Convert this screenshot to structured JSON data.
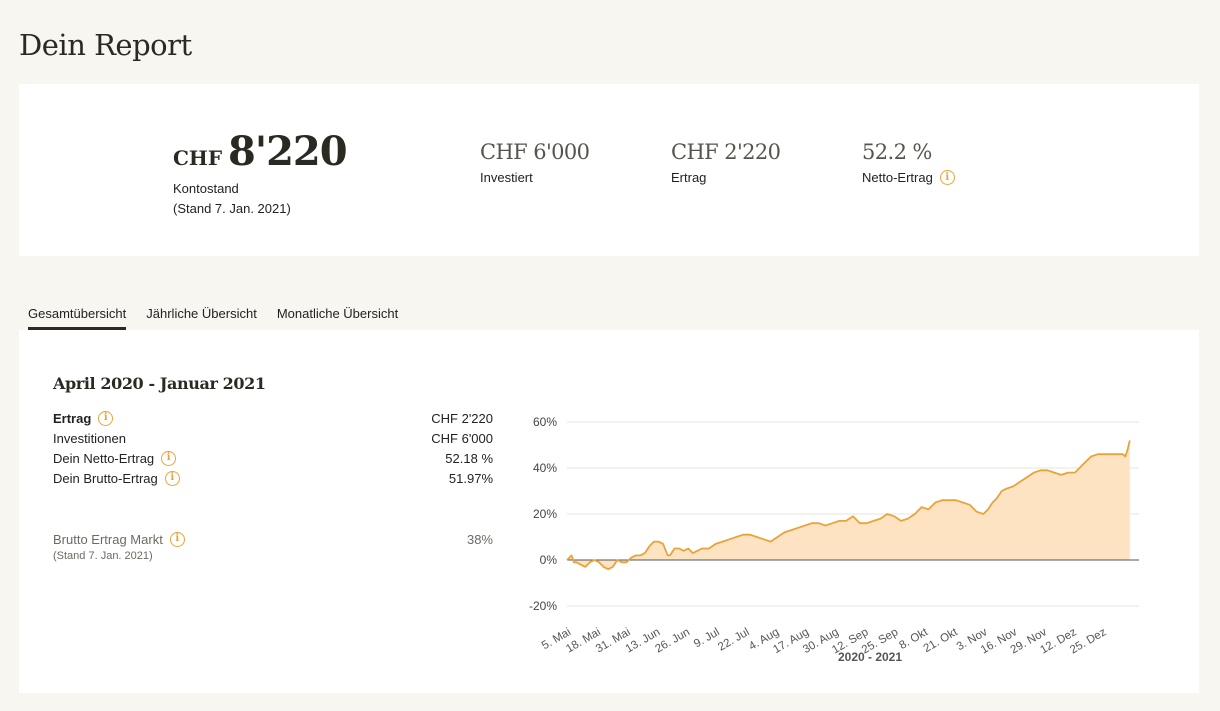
{
  "page": {
    "title": "Dein Report"
  },
  "summary": {
    "balance": {
      "currency": "CHF",
      "value": "8'220",
      "label": "Kontostand",
      "sublabel": "(Stand 7. Jan. 2021)"
    },
    "invested": {
      "value": "CHF 6'000",
      "label": "Investiert"
    },
    "earnings": {
      "value": "CHF 2'220",
      "label": "Ertrag"
    },
    "net_return": {
      "value": "52.2 %",
      "label": "Netto-Ertrag"
    }
  },
  "tabs": [
    {
      "label": "Gesamtübersicht",
      "active": true
    },
    {
      "label": "Jährliche Übersicht",
      "active": false
    },
    {
      "label": "Monatliche Übersicht",
      "active": false
    }
  ],
  "overview": {
    "period": "April 2020 - Januar 2021",
    "rows": [
      {
        "label": "Ertrag",
        "value": "CHF 2'220"
      },
      {
        "label": "Investitionen",
        "value": "CHF 6'000"
      },
      {
        "label": "Dein Netto-Ertrag",
        "value": "52.18 %"
      },
      {
        "label": "Dein Brutto-Ertrag",
        "value": "51.97%"
      }
    ],
    "market": {
      "label": "Brutto Ertrag Markt",
      "value": "38%",
      "sublabel": "(Stand 7. Jan. 2021)"
    }
  },
  "colors": {
    "accent": "#e8a43a",
    "fill": "#fde3c2",
    "text": "#2a2a22",
    "background": "#f8f6f1"
  },
  "chart_data": {
    "type": "area",
    "xlabel": "2020 - 2021",
    "ylabel": "",
    "y_ticks": [
      "60%",
      "40%",
      "20%",
      "0%",
      "-20%"
    ],
    "y_tick_values": [
      60,
      40,
      20,
      0,
      -20
    ],
    "ylim": [
      -20,
      60
    ],
    "x_tick_labels": [
      "5. Mai",
      "18. Mai",
      "31. Mai",
      "13. Jun",
      "26. Jun",
      "9. Jul",
      "22. Jul",
      "4. Aug",
      "17. Aug",
      "30. Aug",
      "12. Sep",
      "25. Sep",
      "8. Okt",
      "21. Okt",
      "3. Nov",
      "16. Nov",
      "29. Nov",
      "12. Dez",
      "25. Dez"
    ],
    "x_tick_days": [
      0,
      13,
      26,
      39,
      52,
      65,
      78,
      91,
      104,
      117,
      130,
      143,
      156,
      169,
      182,
      195,
      208,
      221,
      234
    ],
    "x_range_days": [
      -2,
      248
    ],
    "grid": true,
    "series": [
      {
        "x_days": [
          -2,
          0,
          1,
          2,
          4,
          6,
          8,
          10,
          12,
          14,
          16,
          18,
          20,
          22,
          24,
          26,
          28,
          30,
          32,
          34,
          36,
          38,
          40,
          42,
          43,
          45,
          47,
          49,
          51,
          53,
          55,
          57,
          60,
          63,
          66,
          69,
          72,
          75,
          78,
          81,
          84,
          87,
          90,
          93,
          96,
          99,
          102,
          105,
          108,
          111,
          114,
          117,
          120,
          123,
          126,
          129,
          132,
          135,
          138,
          141,
          144,
          147,
          150,
          153,
          156,
          159,
          162,
          165,
          168,
          171,
          174,
          177,
          180,
          182,
          184,
          186,
          188,
          190,
          193,
          196,
          199,
          202,
          205,
          208,
          211,
          214,
          217,
          220,
          222,
          224,
          227,
          230,
          233,
          236,
          239,
          241,
          242,
          243,
          244
        ],
        "values": [
          0,
          2,
          -1,
          -1,
          -2,
          -3,
          -1,
          0,
          -1,
          -3,
          -4,
          -3,
          0,
          -1,
          -1,
          1,
          2,
          2,
          3,
          6,
          8,
          8,
          7,
          2,
          2,
          5,
          5,
          4,
          5,
          3,
          4,
          5,
          5,
          7,
          8,
          9,
          10,
          11,
          11,
          10,
          9,
          8,
          10,
          12,
          13,
          14,
          15,
          16,
          16,
          15,
          16,
          17,
          17,
          19,
          16,
          16,
          17,
          18,
          20,
          19,
          17,
          18,
          20,
          23,
          22,
          25,
          26,
          26,
          26,
          25,
          24,
          21,
          20,
          22,
          25,
          27,
          30,
          31,
          32,
          34,
          36,
          38,
          39,
          39,
          38,
          37,
          38,
          38,
          40,
          42,
          45,
          46,
          46,
          46,
          46,
          46,
          45,
          48,
          52
        ]
      }
    ]
  }
}
